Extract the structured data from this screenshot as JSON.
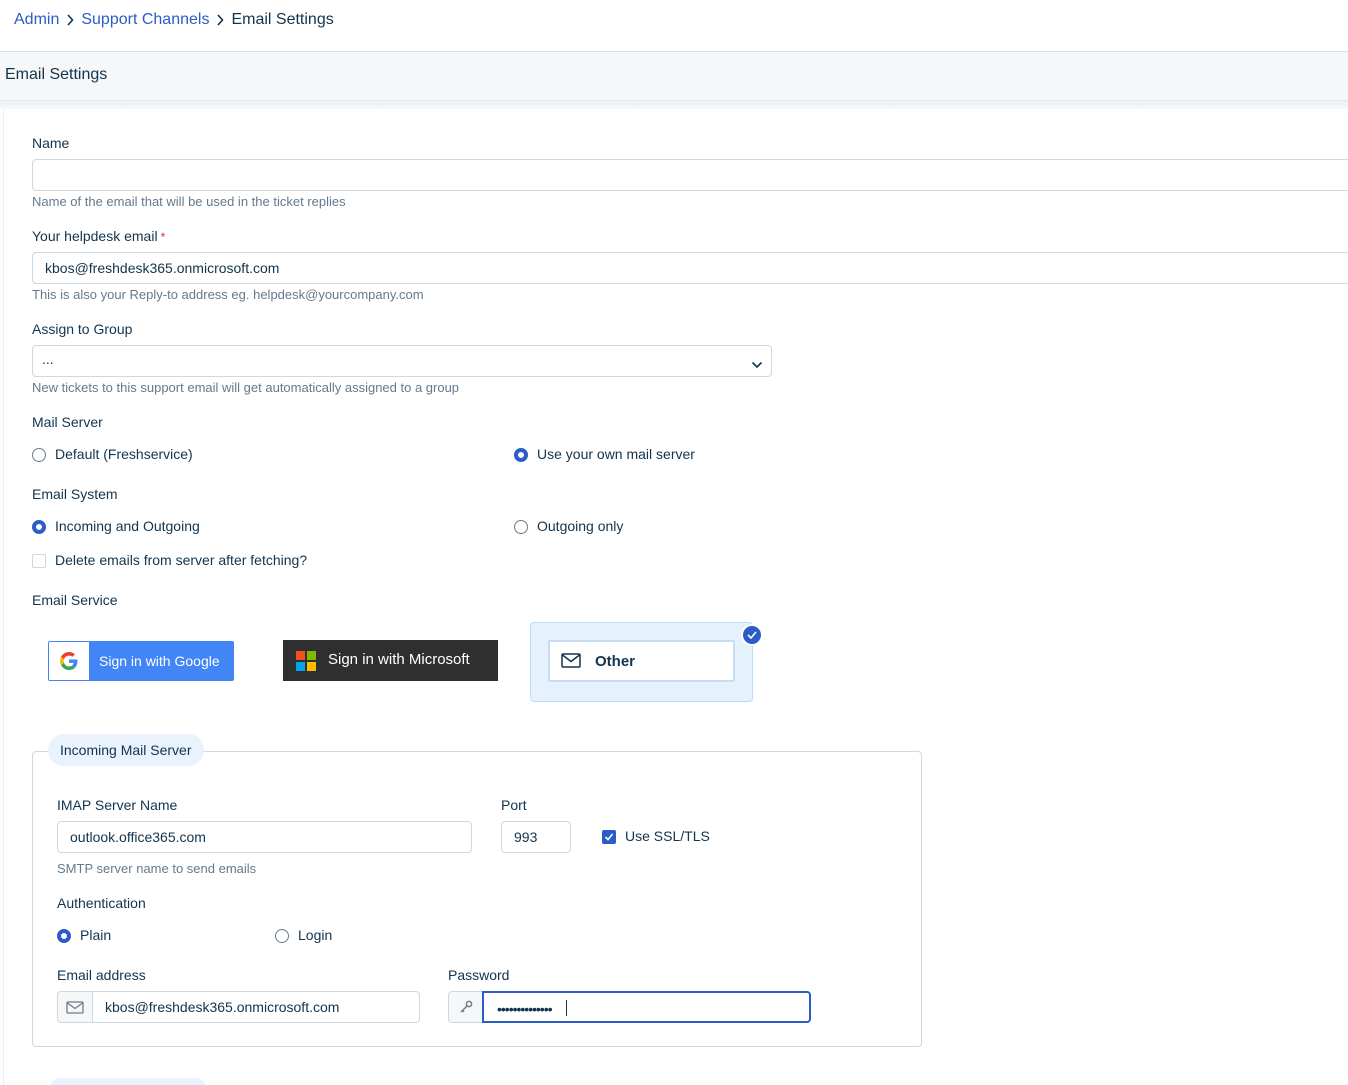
{
  "breadcrumb": {
    "items": [
      "Admin",
      "Support Channels"
    ],
    "current": "Email Settings"
  },
  "header": {
    "title": "Email Settings"
  },
  "form": {
    "name": {
      "label": "Name",
      "value": "",
      "hint": "Name of the email that will be used in the ticket replies"
    },
    "helpdesk_email": {
      "label": "Your helpdesk email",
      "required_mark": "*",
      "value": "kbos@freshdesk365.onmicrosoft.com",
      "hint": "This is also your Reply-to address eg. helpdesk@yourcompany.com"
    },
    "group": {
      "label": "Assign to Group",
      "selected": "...",
      "hint": "New tickets to this support email will get automatically assigned to a group"
    },
    "mail_server": {
      "label": "Mail Server",
      "options": [
        "Default (Freshservice)",
        "Use your own mail server"
      ],
      "selected": "Use your own mail server"
    },
    "email_system": {
      "label": "Email System",
      "options": [
        "Incoming and Outgoing",
        "Outgoing only"
      ],
      "selected": "Incoming and Outgoing",
      "delete_after_fetch": {
        "label": "Delete emails from server after fetching?",
        "checked": false
      }
    },
    "email_service": {
      "label": "Email Service",
      "google": "Sign in with Google",
      "microsoft": "Sign in with Microsoft",
      "other": "Other",
      "selected": "Other"
    },
    "incoming": {
      "legend": "Incoming Mail Server",
      "imap_label": "IMAP Server Name",
      "imap_value": "outlook.office365.com",
      "imap_hint": "SMTP server name to send emails",
      "port_label": "Port",
      "port_value": "993",
      "ssl": {
        "label": "Use SSL/TLS",
        "checked": true
      },
      "auth": {
        "label": "Authentication",
        "options": [
          "Plain",
          "Login"
        ],
        "selected": "Plain"
      },
      "email_label": "Email address",
      "email_value": "kbos@freshdesk365.onmicrosoft.com",
      "password_label": "Password",
      "password_mask": "••••••••••••••"
    }
  },
  "colors": {
    "accent": "#2c5cc5",
    "text": "#12344d",
    "hint": "#647a8e",
    "google_blue": "#4285f4",
    "microsoft_dark": "#2f2f2f",
    "selected_card_bg": "#e5f2fd"
  },
  "icons": [
    "chevron-right-icon",
    "chevron-down-icon",
    "google-logo-icon",
    "microsoft-logo-icon",
    "mail-icon",
    "check-icon",
    "key-icon"
  ]
}
